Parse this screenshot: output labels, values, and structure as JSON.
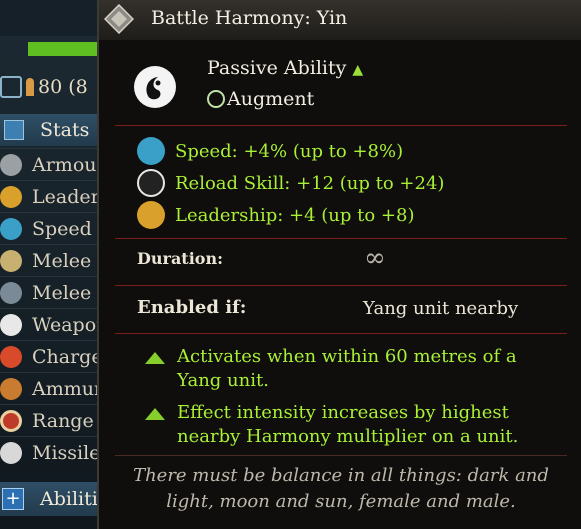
{
  "panel": {
    "unit_count": "80 (8",
    "stats_label": "Stats",
    "stats": [
      {
        "label": "Armour",
        "icon": "armour-icon"
      },
      {
        "label": "Leaders",
        "icon": "leadership-icon"
      },
      {
        "label": "Speed",
        "icon": "speed-icon"
      },
      {
        "label": "Melee A",
        "icon": "melee-attack-icon"
      },
      {
        "label": "Melee D",
        "icon": "melee-defence-icon"
      },
      {
        "label": "Weapon",
        "icon": "weapon-strength-icon"
      },
      {
        "label": "Charge",
        "icon": "charge-icon"
      },
      {
        "label": "Ammunit",
        "icon": "ammunition-icon"
      },
      {
        "label": "Range",
        "icon": "range-icon"
      },
      {
        "label": "Missile",
        "icon": "missile-icon"
      }
    ],
    "abilities_label": "Abiliti"
  },
  "tooltip": {
    "title": "Battle Harmony: Yin",
    "ability_type": "Passive Ability",
    "ability_subtype": "Augment",
    "effects": [
      {
        "text": "Speed: +4% (up to +8%)",
        "icon": "speed-icon",
        "color": "#3aa0c8"
      },
      {
        "text": "Reload Skill: +12 (up to +24)",
        "icon": "reload-icon",
        "color": "#e6e6e6"
      },
      {
        "text": "Leadership: +4 (up to +8)",
        "icon": "leadership-icon",
        "color": "#d9a12c"
      }
    ],
    "duration_label": "Duration:",
    "duration_value": "∞",
    "enabled_label": "Enabled if:",
    "enabled_value": "Yang unit nearby",
    "bullets": [
      "Activates when within 60 metres of a Yang unit.",
      "Effect intensity increases by highest nearby Harmony multiplier on a unit."
    ],
    "flavor_text": "There must be balance in all things: dark and light, moon and sun, female and male."
  },
  "colors": {
    "effect_text": "#a9f036",
    "divider": "#7a1e1e",
    "header_text": "#f4efe4",
    "health_bar": "#5fbf22"
  }
}
